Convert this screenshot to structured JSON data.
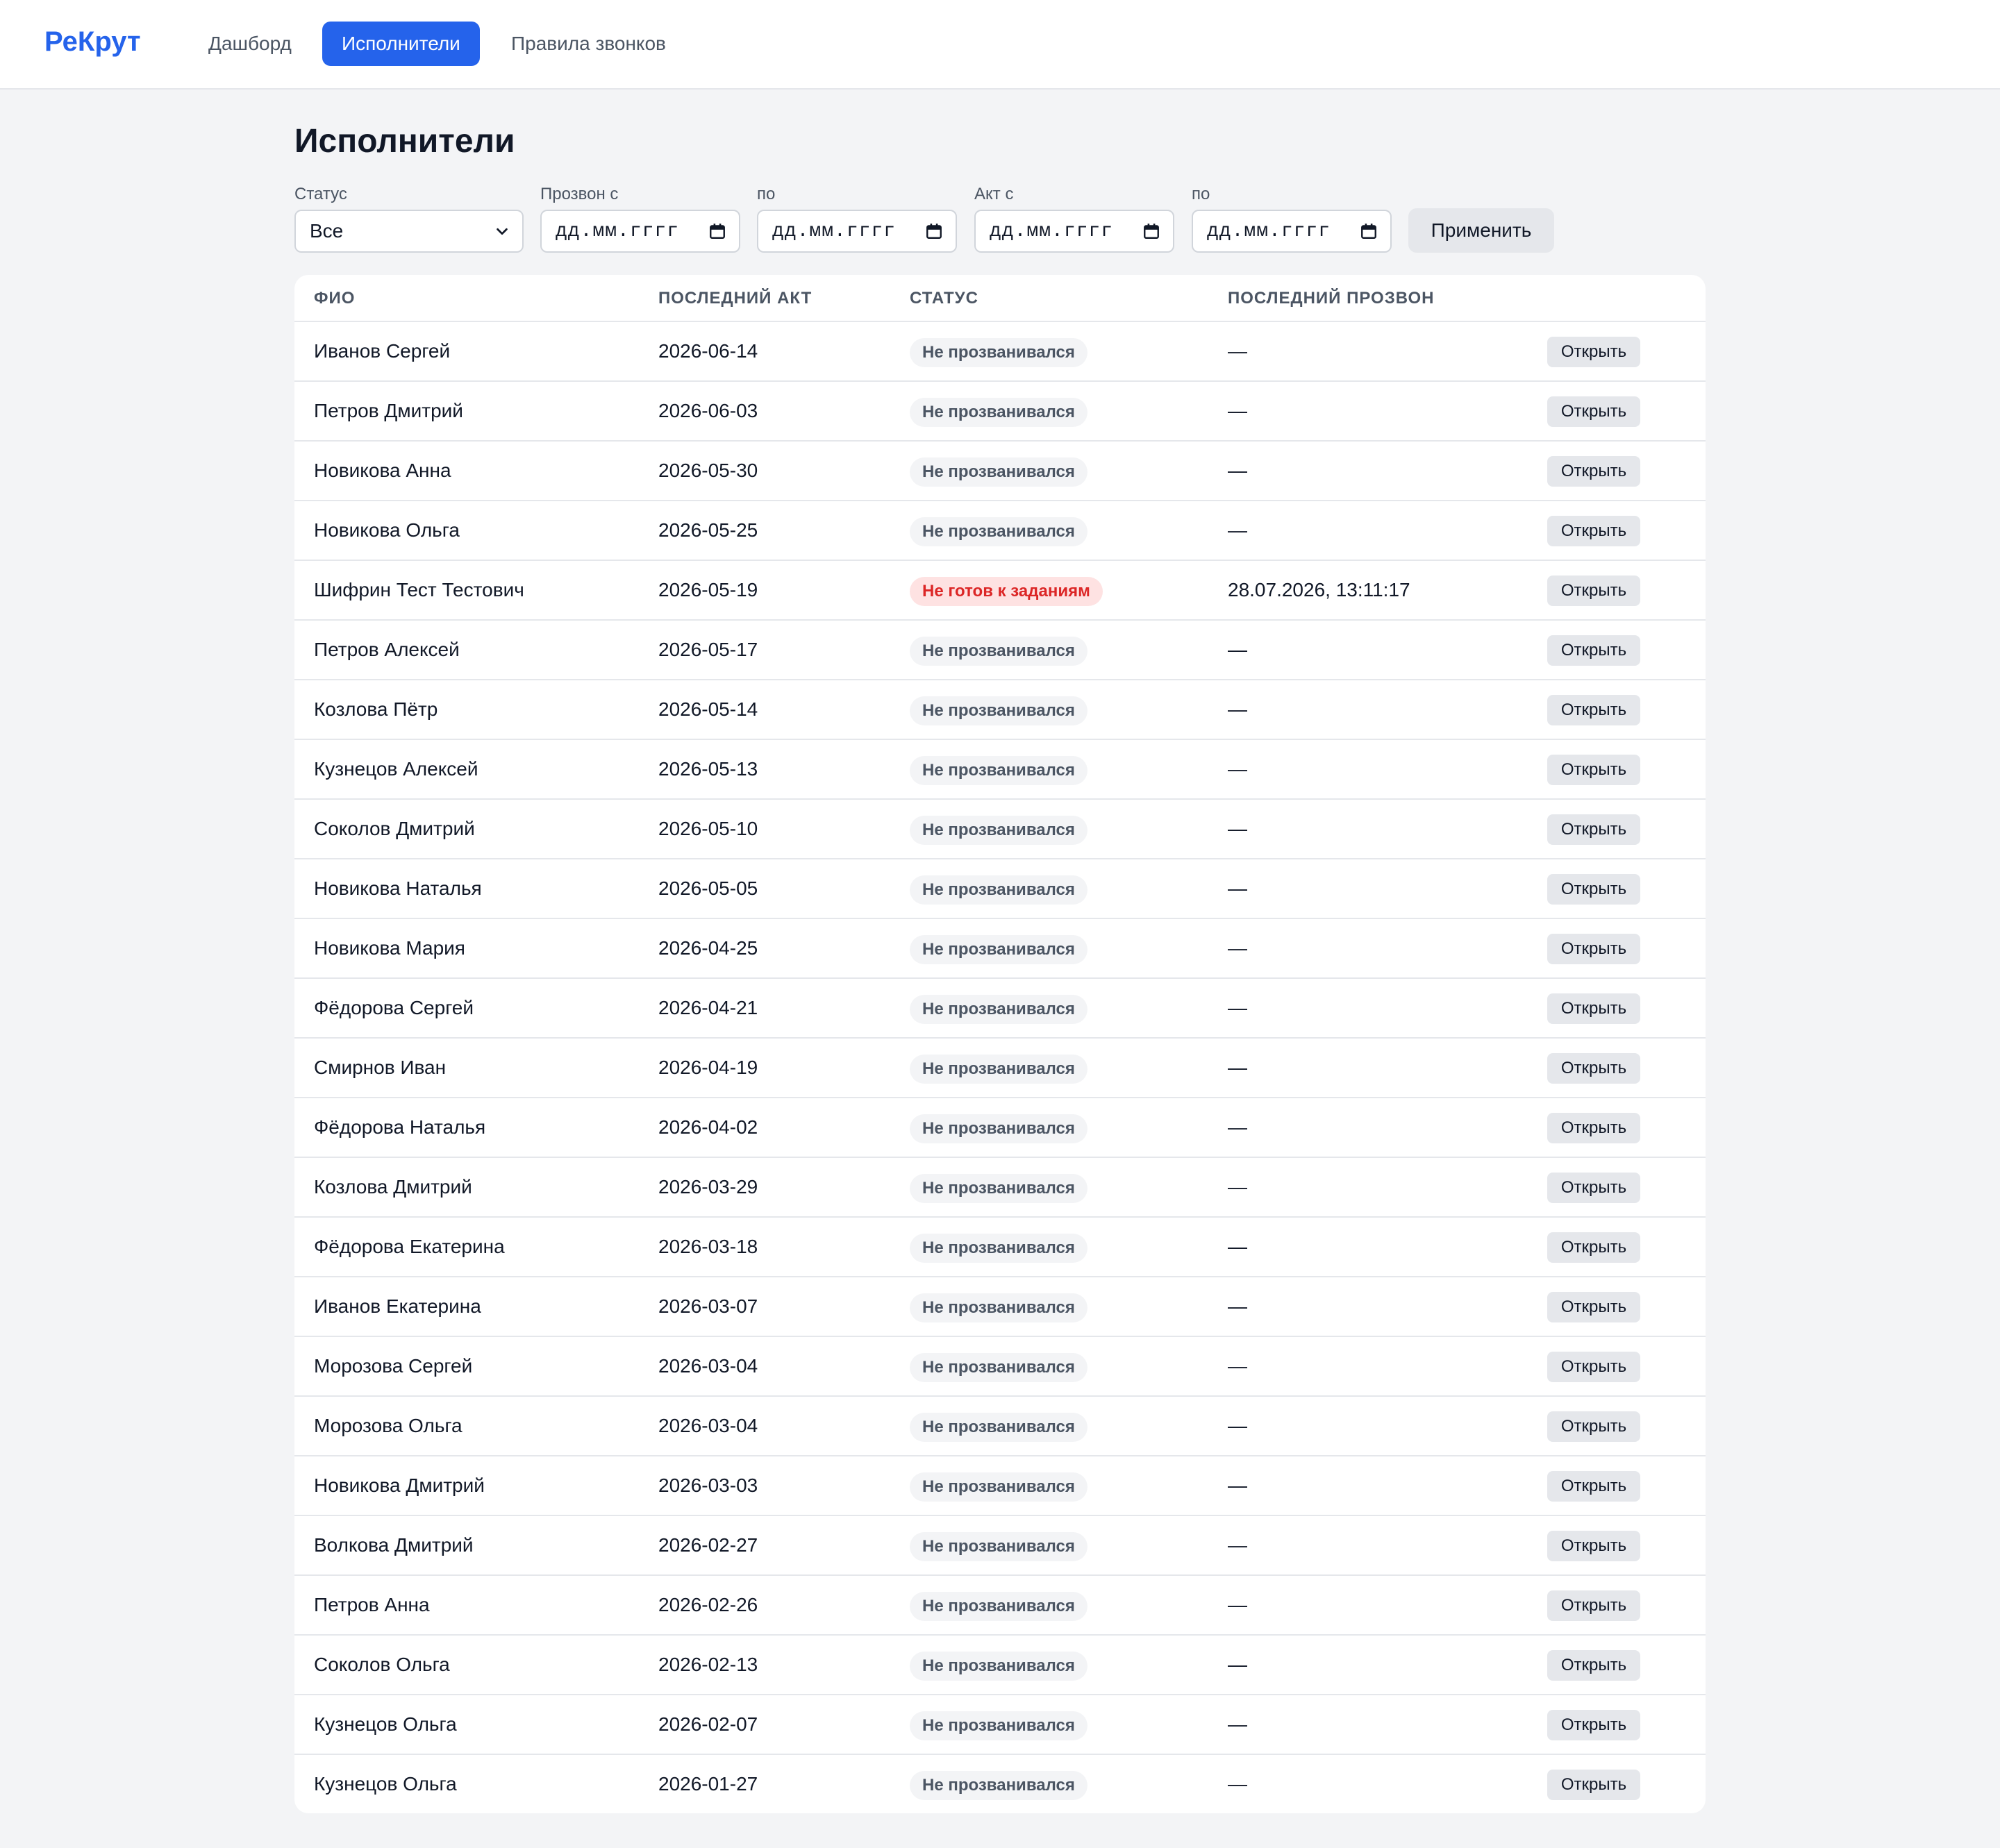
{
  "app": {
    "brand": "РеКрут"
  },
  "nav": {
    "dashboard": "Дашборд",
    "executors": "Исполнители",
    "call_rules": "Правила звонков"
  },
  "page": {
    "title": "Исполнители"
  },
  "filters": {
    "status_label": "Статус",
    "status_value": "Все",
    "call_from_label": "Прозвон с",
    "call_to_label": "по",
    "act_from_label": "Акт с",
    "act_to_label": "по",
    "date_placeholder": "дд.мм.гггг",
    "apply_label": "Применить"
  },
  "table": {
    "headers": {
      "name": "ФИО",
      "last_act": "ПОСЛЕДНИЙ АКТ",
      "status": "СТАТУС",
      "last_call": "ПОСЛЕДНИЙ ПРОЗВОН"
    },
    "open_label": "Открыть",
    "rows": [
      {
        "name": "Иванов Сергей",
        "act": "2026-06-14",
        "status": "Не прозванивался",
        "status_kind": "gray",
        "call": "—"
      },
      {
        "name": "Петров Дмитрий",
        "act": "2026-06-03",
        "status": "Не прозванивался",
        "status_kind": "gray",
        "call": "—"
      },
      {
        "name": "Новикова Анна",
        "act": "2026-05-30",
        "status": "Не прозванивался",
        "status_kind": "gray",
        "call": "—"
      },
      {
        "name": "Новикова Ольга",
        "act": "2026-05-25",
        "status": "Не прозванивался",
        "status_kind": "gray",
        "call": "—"
      },
      {
        "name": "Шифрин Тест Тестович",
        "act": "2026-05-19",
        "status": "Не готов к заданиям",
        "status_kind": "red",
        "call": "28.07.2026, 13:11:17"
      },
      {
        "name": "Петров Алексей",
        "act": "2026-05-17",
        "status": "Не прозванивался",
        "status_kind": "gray",
        "call": "—"
      },
      {
        "name": "Козлова Пётр",
        "act": "2026-05-14",
        "status": "Не прозванивался",
        "status_kind": "gray",
        "call": "—"
      },
      {
        "name": "Кузнецов Алексей",
        "act": "2026-05-13",
        "status": "Не прозванивался",
        "status_kind": "gray",
        "call": "—"
      },
      {
        "name": "Соколов Дмитрий",
        "act": "2026-05-10",
        "status": "Не прозванивался",
        "status_kind": "gray",
        "call": "—"
      },
      {
        "name": "Новикова Наталья",
        "act": "2026-05-05",
        "status": "Не прозванивался",
        "status_kind": "gray",
        "call": "—"
      },
      {
        "name": "Новикова Мария",
        "act": "2026-04-25",
        "status": "Не прозванивался",
        "status_kind": "gray",
        "call": "—"
      },
      {
        "name": "Фёдорова Сергей",
        "act": "2026-04-21",
        "status": "Не прозванивался",
        "status_kind": "gray",
        "call": "—"
      },
      {
        "name": "Смирнов Иван",
        "act": "2026-04-19",
        "status": "Не прозванивался",
        "status_kind": "gray",
        "call": "—"
      },
      {
        "name": "Фёдорова Наталья",
        "act": "2026-04-02",
        "status": "Не прозванивался",
        "status_kind": "gray",
        "call": "—"
      },
      {
        "name": "Козлова Дмитрий",
        "act": "2026-03-29",
        "status": "Не прозванивался",
        "status_kind": "gray",
        "call": "—"
      },
      {
        "name": "Фёдорова Екатерина",
        "act": "2026-03-18",
        "status": "Не прозванивался",
        "status_kind": "gray",
        "call": "—"
      },
      {
        "name": "Иванов Екатерина",
        "act": "2026-03-07",
        "status": "Не прозванивался",
        "status_kind": "gray",
        "call": "—"
      },
      {
        "name": "Морозова Сергей",
        "act": "2026-03-04",
        "status": "Не прозванивался",
        "status_kind": "gray",
        "call": "—"
      },
      {
        "name": "Морозова Ольга",
        "act": "2026-03-04",
        "status": "Не прозванивался",
        "status_kind": "gray",
        "call": "—"
      },
      {
        "name": "Новикова Дмитрий",
        "act": "2026-03-03",
        "status": "Не прозванивался",
        "status_kind": "gray",
        "call": "—"
      },
      {
        "name": "Волкова Дмитрий",
        "act": "2026-02-27",
        "status": "Не прозванивался",
        "status_kind": "gray",
        "call": "—"
      },
      {
        "name": "Петров Анна",
        "act": "2026-02-26",
        "status": "Не прозванивался",
        "status_kind": "gray",
        "call": "—"
      },
      {
        "name": "Соколов Ольга",
        "act": "2026-02-13",
        "status": "Не прозванивался",
        "status_kind": "gray",
        "call": "—"
      },
      {
        "name": "Кузнецов Ольга",
        "act": "2026-02-07",
        "status": "Не прозванивался",
        "status_kind": "gray",
        "call": "—"
      },
      {
        "name": "Кузнецов Ольга",
        "act": "2026-01-27",
        "status": "Не прозванивался",
        "status_kind": "gray",
        "call": "—"
      }
    ]
  },
  "colors": {
    "accent": "#2563eb",
    "page_bg": "#f3f4f6",
    "badge_gray_bg": "#f3f4f6",
    "badge_red_bg": "#fee2e2",
    "badge_red_text": "#dc2626"
  },
  "icons": {
    "select_arrow": "chevron-down-icon",
    "date_picker": "calendar-icon"
  }
}
